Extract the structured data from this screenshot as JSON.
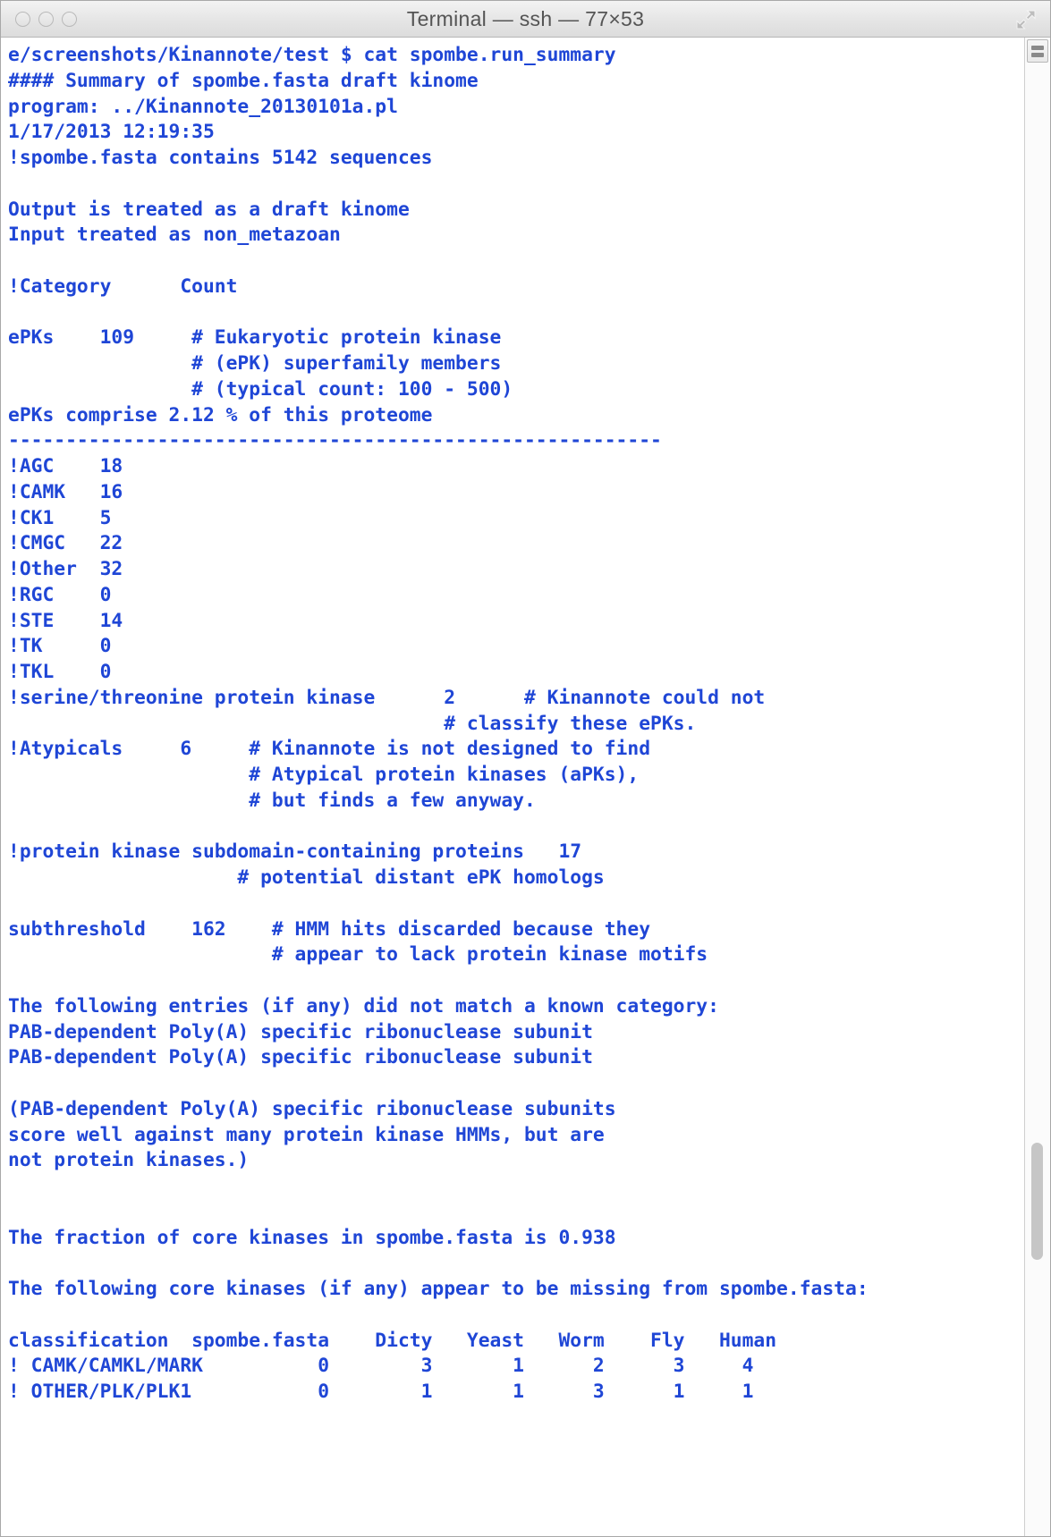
{
  "window": {
    "title": "Terminal — ssh — 77×53",
    "traffic_lights": [
      "close",
      "minimize",
      "zoom"
    ],
    "expand_icon": "fullscreen-expand-icon",
    "text_color": "#1f46d6",
    "background_color": "#ffffff"
  },
  "scrollbar": {
    "top_button_icon": "scroll-lines-icon",
    "thumb_top_pct": 73.5,
    "thumb_height_pct": 8.0
  },
  "terminal": {
    "prompt_line": "e/screenshots/Kinannote/test $ cat spombe.run_summary",
    "command": "cat spombe.run_summary",
    "header": {
      "summary_title": "#### Summary of spombe.fasta draft kinome",
      "program": "program: ../Kinannote_20130101a.pl",
      "timestamp": "1/17/2013 12:19:35",
      "sequence_count_line": "!spombe.fasta contains 5142 sequences",
      "output_note": "Output is treated as a draft kinome",
      "input_note": "Input treated as non_metazoan"
    },
    "category_table": {
      "col_category": "!Category",
      "col_count": "Count",
      "epk_label": "ePKs",
      "epk_count": "109",
      "epk_comments": [
        "# Eukaryotic protein kinase",
        "# (ePK) superfamily members",
        "# (typical count: 100 - 500)"
      ],
      "epk_percent_line": "ePKs comprise 2.12 % of this proteome",
      "separator": "---------------------------------------------------------",
      "groups": [
        {
          "name": "!AGC",
          "count": "18"
        },
        {
          "name": "!CAMK",
          "count": "16"
        },
        {
          "name": "!CK1",
          "count": "5"
        },
        {
          "name": "!CMGC",
          "count": "22"
        },
        {
          "name": "!Other",
          "count": "32"
        },
        {
          "name": "!RGC",
          "count": "0"
        },
        {
          "name": "!STE",
          "count": "14"
        },
        {
          "name": "!TK",
          "count": "0"
        },
        {
          "name": "!TKL",
          "count": "0"
        }
      ],
      "serine_threonine": {
        "label": "!serine/threonine protein kinase",
        "count": "2",
        "comments": [
          "# Kinannote could not",
          "# classify these ePKs."
        ]
      },
      "atypicals": {
        "label": "!Atypicals",
        "count": "6",
        "comments": [
          "# Kinannote is not designed to find",
          "# Atypical protein kinases (aPKs),",
          "# but finds a few anyway."
        ]
      },
      "subdomain": {
        "label": "!protein kinase subdomain-containing proteins",
        "count": "17",
        "comments": [
          "# potential distant ePK homologs"
        ]
      },
      "subthreshold": {
        "label": "subthreshold",
        "count": "162",
        "comments": [
          "# HMM hits discarded because they",
          "# appear to lack protein kinase motifs"
        ]
      }
    },
    "unmatched": {
      "heading": "The following entries (if any) did not match a known category:",
      "entries": [
        "PAB-dependent Poly(A) specific ribonuclease subunit",
        "PAB-dependent Poly(A) specific ribonuclease subunit"
      ],
      "note_lines": [
        "(PAB-dependent Poly(A) specific ribonuclease subunits",
        "score well against many protein kinase HMMs, but are",
        "not protein kinases.)"
      ]
    },
    "core_kinases": {
      "fraction_line": "The fraction of core kinases in spombe.fasta is 0.938",
      "fraction_value": "0.938",
      "missing_heading": "The following core kinases (if any) appear to be missing from spombe.fasta:",
      "table": {
        "headers": [
          "classification",
          "spombe.fasta",
          "Dicty",
          "Yeast",
          "Worm",
          "Fly",
          "Human"
        ],
        "rows": [
          [
            "! CAMK/CAMKL/MARK",
            "0",
            "3",
            "1",
            "2",
            "3",
            "4"
          ],
          [
            "! OTHER/PLK/PLK1",
            "0",
            "1",
            "1",
            "3",
            "1",
            "1"
          ]
        ]
      }
    },
    "full_text": "e/screenshots/Kinannote/test $ cat spombe.run_summary\n#### Summary of spombe.fasta draft kinome\nprogram: ../Kinannote_20130101a.pl\n1/17/2013 12:19:35\n!spombe.fasta contains 5142 sequences\n\nOutput is treated as a draft kinome\nInput treated as non_metazoan\n\n!Category      Count\n\nePKs    109     # Eukaryotic protein kinase\n                # (ePK) superfamily members\n                # (typical count: 100 - 500)\nePKs comprise 2.12 % of this proteome\n---------------------------------------------------------\n!AGC    18\n!CAMK   16\n!CK1    5\n!CMGC   22\n!Other  32\n!RGC    0\n!STE    14\n!TK     0\n!TKL    0\n!serine/threonine protein kinase      2      # Kinannote could not\n                                      # classify these ePKs.\n!Atypicals     6     # Kinannote is not designed to find\n                     # Atypical protein kinases (aPKs),\n                     # but finds a few anyway.\n\n!protein kinase subdomain-containing proteins   17\n                    # potential distant ePK homologs\n\nsubthreshold    162    # HMM hits discarded because they\n                       # appear to lack protein kinase motifs\n\nThe following entries (if any) did not match a known category:\nPAB-dependent Poly(A) specific ribonuclease subunit\nPAB-dependent Poly(A) specific ribonuclease subunit\n\n(PAB-dependent Poly(A) specific ribonuclease subunits\nscore well against many protein kinase HMMs, but are\nnot protein kinases.)\n\n\nThe fraction of core kinases in spombe.fasta is 0.938\n\nThe following core kinases (if any) appear to be missing from spombe.fasta:\n\nclassification  spombe.fasta    Dicty   Yeast   Worm    Fly   Human\n! CAMK/CAMKL/MARK          0        3       1      2      3     4\n! OTHER/PLK/PLK1           0        1       1      3      1     1"
  }
}
